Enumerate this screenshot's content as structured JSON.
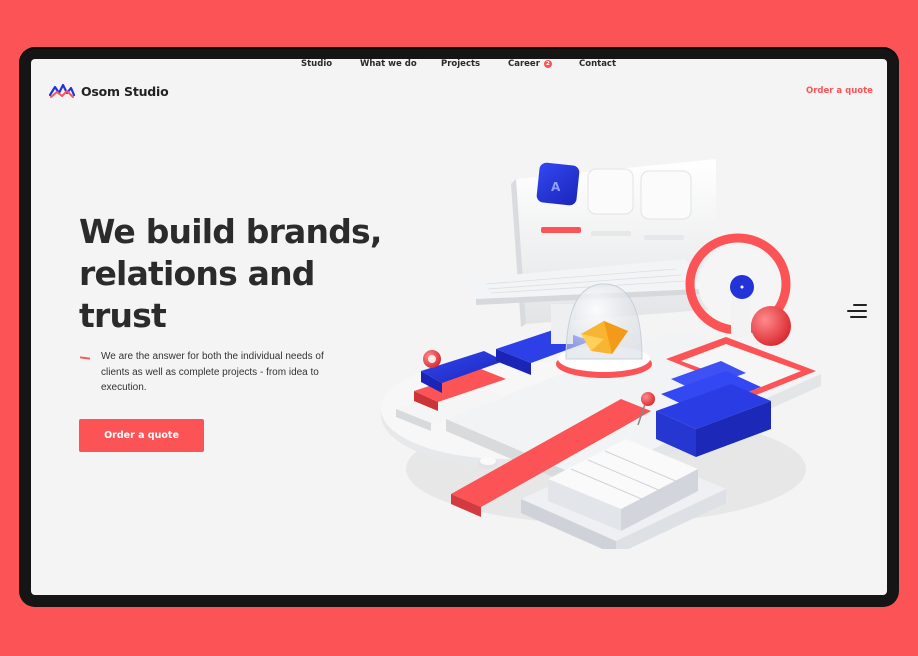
{
  "brand": {
    "name": "Osom Studio"
  },
  "nav": {
    "items": [
      {
        "label": "Studio"
      },
      {
        "label": "What we do"
      },
      {
        "label": "Projects"
      },
      {
        "label": "Career",
        "badge": "2"
      },
      {
        "label": "Contact"
      }
    ],
    "order_label": "Order a quote"
  },
  "hero": {
    "headline_lines": [
      "We build brands,",
      "relations and",
      "trust"
    ],
    "description": "We are the answer for both the individual needs of clients as well as complete projects - from idea to execution.",
    "cta_label": "Order a quote"
  },
  "icons": [
    "osom-logo-icon",
    "hamburger-menu-icon"
  ],
  "colors": {
    "background": "#fb5356",
    "accent": "#fb5356",
    "screen": "#f4f4f4",
    "blue": "#2233d8",
    "text": "#2b2b2b"
  }
}
